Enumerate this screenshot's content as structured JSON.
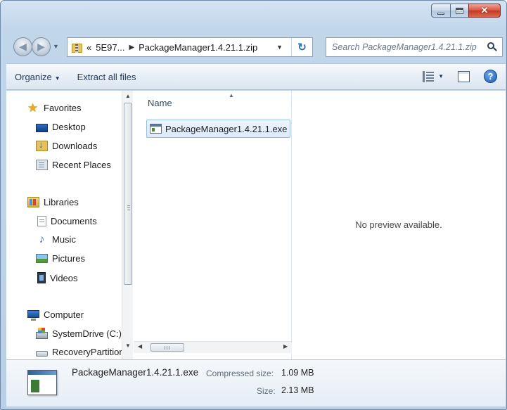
{
  "window": {
    "controls": {
      "minimize_icon": "minimize-icon",
      "maximize_icon": "maximize-icon",
      "close_glyph": "✕"
    }
  },
  "address_bar": {
    "overflow": "«",
    "segments": [
      "5E97...",
      "PackageManager1.4.21.1.zip"
    ],
    "separator": "▶"
  },
  "search": {
    "placeholder": "Search PackageManager1.4.21.1.zip"
  },
  "toolbar": {
    "organize_label": "Organize",
    "extract_label": "Extract all files",
    "help_glyph": "?"
  },
  "nav_pane": {
    "favorites": {
      "label": "Favorites",
      "items": [
        "Desktop",
        "Downloads",
        "Recent Places"
      ]
    },
    "libraries": {
      "label": "Libraries",
      "items": [
        "Documents",
        "Music",
        "Pictures",
        "Videos"
      ]
    },
    "computer": {
      "label": "Computer",
      "items": [
        "SystemDrive (C:)",
        "RecoveryPartition"
      ]
    }
  },
  "file_list": {
    "column_name": "Name",
    "files": [
      {
        "name": "PackageManager1.4.21.1.exe",
        "selected": true
      }
    ]
  },
  "preview": {
    "message": "No preview available."
  },
  "details": {
    "file_name": "PackageManager1.4.21.1.exe",
    "compressed_label": "Compressed size:",
    "compressed_value": "1.09 MB",
    "size_label": "Size:",
    "size_value": "2.13 MB"
  },
  "colors": {
    "selection": "#dbeafc",
    "accent": "#1e395b",
    "close_button": "#c23a22"
  }
}
